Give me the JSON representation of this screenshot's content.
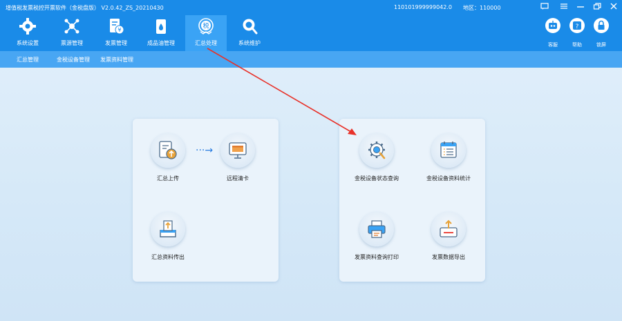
{
  "titlebar": {
    "app_title": "增值税发票税控开票软件（金税盘版） V2.0.42_ZS_20210430",
    "tax_id": "110101999999042.0",
    "region": "地区：110000"
  },
  "toolbar": {
    "items": [
      {
        "label": "系统设置"
      },
      {
        "label": "票源管理"
      },
      {
        "label": "发票管理"
      },
      {
        "label": "成品油管理"
      },
      {
        "label": "汇总处理"
      },
      {
        "label": "系统维护"
      }
    ],
    "right": [
      {
        "label": "客服"
      },
      {
        "label": "帮助"
      },
      {
        "label": "锁屏"
      }
    ]
  },
  "subnav": {
    "items": [
      {
        "label": "汇总管理"
      },
      {
        "label": "金税设备管理"
      },
      {
        "label": "发票资料管理"
      }
    ]
  },
  "left_panel": {
    "items": [
      {
        "label": "汇总上传",
        "icon": "upload-document-icon"
      },
      {
        "label": "远程清卡",
        "icon": "monitor-card-icon"
      },
      {
        "label": "汇总资料传出",
        "icon": "export-tray-icon"
      }
    ],
    "arrow": "···→"
  },
  "right_panel": {
    "items": [
      {
        "label": "金税设备状态查询",
        "icon": "gear-magnifier-icon"
      },
      {
        "label": "金税设备资料统计",
        "icon": "calendar-list-icon"
      },
      {
        "label": "发票资料查询打印",
        "icon": "printer-icon"
      },
      {
        "label": "发票数据导出",
        "icon": "export-box-icon"
      }
    ]
  },
  "colors": {
    "toolbar_bg": "#1a8be8",
    "active_tab": "#3aa3f5",
    "subnav_bg": "#48a6f3",
    "annotation_arrow": "#e8322a"
  }
}
